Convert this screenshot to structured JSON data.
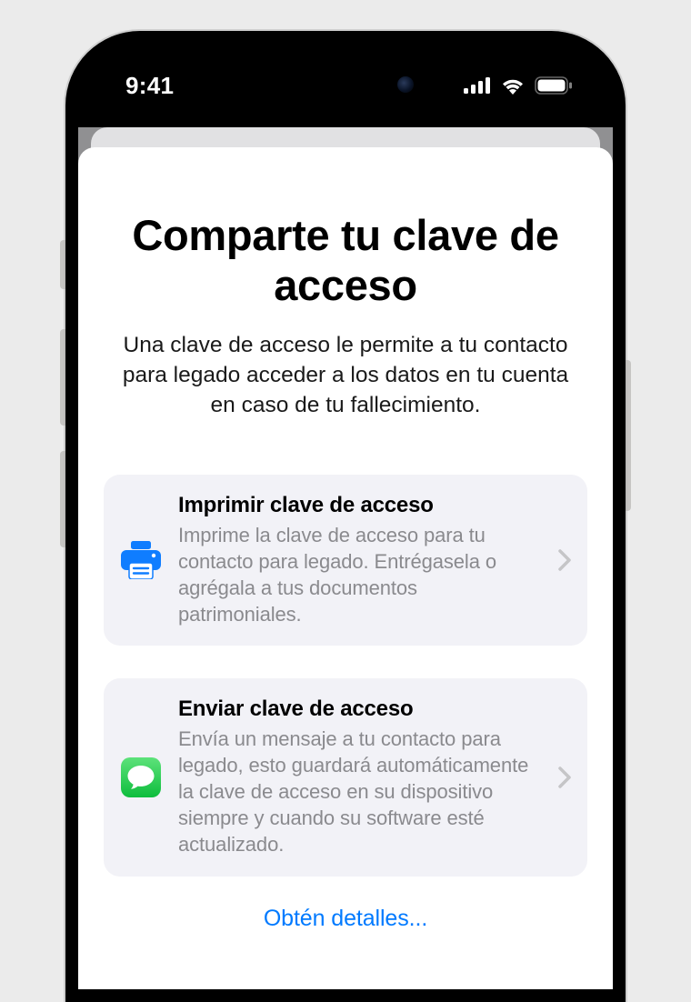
{
  "statusBar": {
    "time": "9:41"
  },
  "sheet": {
    "title": "Comparte tu clave de acceso",
    "subtitle": "Una clave de acceso le permite a tu contacto para legado acceder a los datos en tu cuenta en caso de tu fallecimiento.",
    "options": [
      {
        "title": "Imprimir clave de acceso",
        "description": "Imprime la clave de acceso para tu contacto para legado. Entrégasela o agrégala a tus documentos patrimoniales."
      },
      {
        "title": "Enviar clave de acceso",
        "description": "Envía un mensaje a tu contacto para legado, esto guardará automáticamente la clave de acceso en su dispositivo siempre y cuando su software esté actualizado."
      }
    ],
    "detailsLink": "Obtén detalles..."
  },
  "colors": {
    "accent": "#007aff",
    "messagesGreen": "#31c859",
    "cardBg": "#f2f2f7",
    "secondaryText": "#8a8a8e"
  }
}
